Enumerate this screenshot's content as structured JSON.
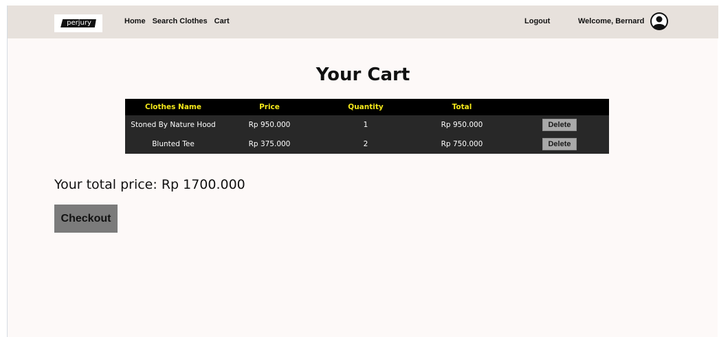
{
  "header": {
    "logo_text": "perjury",
    "nav": [
      "Home",
      "Search Clothes",
      "Cart"
    ],
    "logout": "Logout",
    "welcome": "Welcome, Bernard",
    "avatar_icon": "user-circle-icon"
  },
  "cart": {
    "title": "Your Cart",
    "columns": [
      "Clothes Name",
      "Price",
      "Quantity",
      "Total",
      ""
    ],
    "rows": [
      {
        "name": "Stoned By Nature Hood",
        "price": "Rp 950.000",
        "quantity": "1",
        "total": "Rp 950.000",
        "action": "Delete"
      },
      {
        "name": "Blunted Tee",
        "price": "Rp 375.000",
        "quantity": "2",
        "total": "Rp 750.000",
        "action": "Delete"
      }
    ],
    "total_label": "Your total price: Rp 1700.000",
    "checkout_label": "Checkout"
  },
  "colors": {
    "header_bg": "#e7e1dc",
    "page_bg": "#fdf9f8",
    "table_header_bg": "#000000",
    "table_header_text": "#f4e81a",
    "table_row_bg": "#282828",
    "delete_button_bg": "#a9a9a9",
    "checkout_button_bg": "#7b7b7b"
  }
}
